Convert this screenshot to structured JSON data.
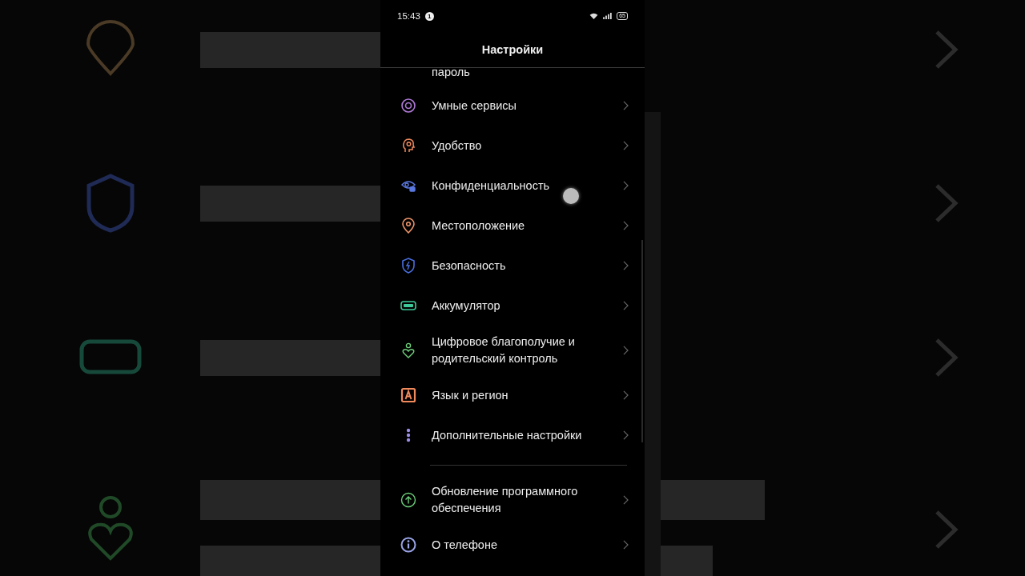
{
  "status_bar": {
    "time": "15:43",
    "notification_count": "1",
    "battery": "65"
  },
  "header": {
    "title": "Настройки"
  },
  "partial_item": {
    "label": "пароль"
  },
  "sections": [
    {
      "items": [
        {
          "label": "Умные сервисы",
          "kind": "target",
          "color": "#b07ad8"
        },
        {
          "label": "Удобство",
          "kind": "head",
          "color": "#f08a5d"
        },
        {
          "label": "Конфиденциальность",
          "kind": "eye-lock",
          "color": "#5a78e0"
        },
        {
          "label": "Местоположение",
          "kind": "pin",
          "color": "#f0956a"
        },
        {
          "label": "Безопасность",
          "kind": "shield",
          "color": "#4a6fe0"
        },
        {
          "label": "Аккумулятор",
          "kind": "battery",
          "color": "#3ec99a"
        },
        {
          "label": "Цифровое благополучие и родительский контроль",
          "kind": "heart",
          "color": "#6ccf7a"
        },
        {
          "label": "Язык и регион",
          "kind": "letter",
          "color": "#f08a5d"
        },
        {
          "label": "Дополнительные настройки",
          "kind": "dots",
          "color": "#9a8ee8"
        }
      ]
    },
    {
      "items": [
        {
          "label": "Обновление программного обеспечения",
          "kind": "up",
          "color": "#6ccf7a"
        },
        {
          "label": "О телефоне",
          "kind": "info",
          "color": "#9aa4e8"
        }
      ]
    }
  ]
}
